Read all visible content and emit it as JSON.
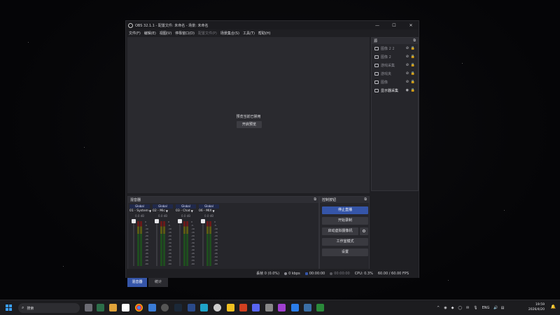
{
  "window": {
    "title": "OBS 32.1.1 - 配置文件: 未命名 - 场景: 未命名",
    "controls": {
      "minimize": "—",
      "maximize": "☐",
      "close": "✕"
    }
  },
  "menu": [
    {
      "label": "文件(F)",
      "disabled": false
    },
    {
      "label": "编辑(E)",
      "disabled": false
    },
    {
      "label": "视图(V)",
      "disabled": false
    },
    {
      "label": "停靠窗口(D)",
      "disabled": false
    },
    {
      "label": "配置文件(P)",
      "disabled": true
    },
    {
      "label": "场景集合(S)",
      "disabled": false
    },
    {
      "label": "工具(T)",
      "disabled": false
    },
    {
      "label": "帮助(H)",
      "disabled": false
    }
  ],
  "preview": {
    "message": "预览当前已禁用",
    "enable_button": "开启预览"
  },
  "sources": {
    "header": "源",
    "items": [
      {
        "label": "图像 2 2",
        "active": false
      },
      {
        "label": "图像 2",
        "active": false
      },
      {
        "label": "游戏采集",
        "active": false
      },
      {
        "label": "游戏夹",
        "active": false
      },
      {
        "label": "图像",
        "active": false
      },
      {
        "label": "显示器采集",
        "active": true
      }
    ]
  },
  "mixer": {
    "header": "混音器",
    "channels": [
      {
        "scope": "Global",
        "name": "01 - System",
        "db": "0.0 dB"
      },
      {
        "scope": "Global",
        "name": "02 - Mic",
        "db": "0.0 dB"
      },
      {
        "scope": "Global",
        "name": "03 - Chat",
        "db": "0.0 dB"
      },
      {
        "scope": "Global",
        "name": "06 - MIX",
        "db": "0.0 dB"
      }
    ],
    "scale": [
      "0",
      "-5",
      "-10",
      "-15",
      "-20",
      "-25",
      "-30",
      "-35",
      "-40",
      "-45",
      "-50",
      "-55",
      "-60"
    ],
    "tabs": [
      {
        "label": "混音器",
        "active": true
      },
      {
        "label": "统计",
        "active": false
      }
    ]
  },
  "controls": {
    "header": "控制按钮",
    "stop_stream": "停止直播",
    "start_record": "开始录制",
    "virtual_camera": "启动虚拟摄像机",
    "studio_mode": "工作室模式",
    "settings": "设置"
  },
  "statusbar": {
    "dropped_frames": "丢帧 0 (0.0%)",
    "bitrate": "0 kbps",
    "stream_time": "00:00:00",
    "record_time": "00:00:00",
    "cpu": "CPU: 0.3%",
    "fps": "60.00 / 60.00 FPS"
  },
  "taskbar": {
    "search_label": "搜索",
    "language": "ENG",
    "time": "19:59",
    "date": "2026/4/20"
  },
  "colors": {
    "accent": "#3555a8",
    "window_bg": "#1f1f23",
    "preview_bg": "#2a2a2f"
  }
}
